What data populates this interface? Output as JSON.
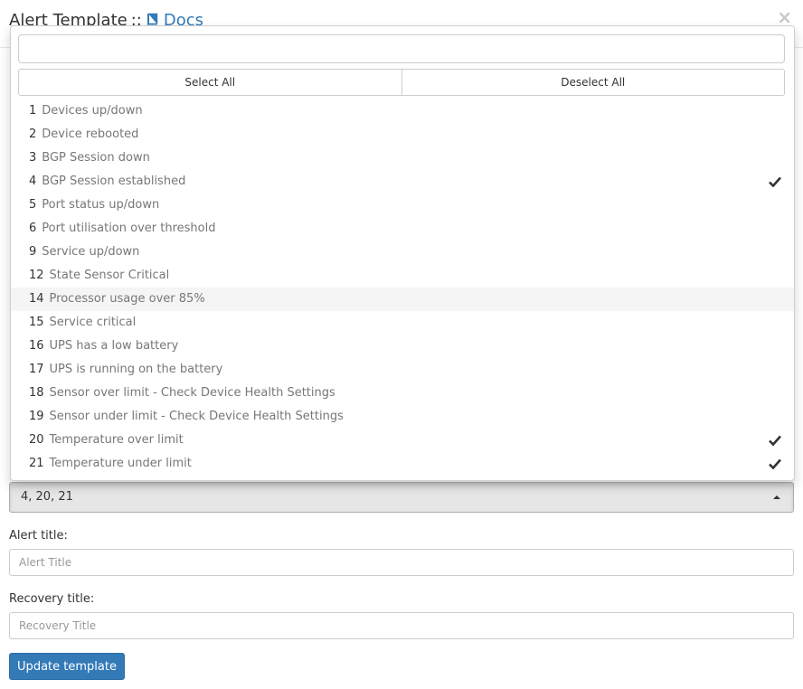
{
  "modal": {
    "title": "Alert Template",
    "separator": "::",
    "docs_label": "Docs",
    "close_label": "×"
  },
  "dropdown": {
    "search_value": "",
    "select_all": "Select All",
    "deselect_all": "Deselect All",
    "options": [
      {
        "num": "1",
        "label": "Devices up/down",
        "checked": false
      },
      {
        "num": "2",
        "label": "Device rebooted",
        "checked": false
      },
      {
        "num": "3",
        "label": "BGP Session down",
        "checked": false
      },
      {
        "num": "4",
        "label": "BGP Session established",
        "checked": true
      },
      {
        "num": "5",
        "label": "Port status up/down",
        "checked": false
      },
      {
        "num": "6",
        "label": "Port utilisation over threshold",
        "checked": false
      },
      {
        "num": "9",
        "label": "Service up/down",
        "checked": false
      },
      {
        "num": "12",
        "label": "State Sensor Critical",
        "checked": false
      },
      {
        "num": "14",
        "label": "Processor usage over 85%",
        "checked": false
      },
      {
        "num": "15",
        "label": "Service critical",
        "checked": false
      },
      {
        "num": "16",
        "label": "UPS has a low battery",
        "checked": false
      },
      {
        "num": "17",
        "label": "UPS is running on the battery",
        "checked": false
      },
      {
        "num": "18",
        "label": "Sensor over limit - Check Device Health Settings",
        "checked": false
      },
      {
        "num": "19",
        "label": "Sensor under limit - Check Device Health Settings",
        "checked": false
      },
      {
        "num": "20",
        "label": "Temperature over limit",
        "checked": true
      },
      {
        "num": "21",
        "label": "Temperature under limit",
        "checked": true
      }
    ]
  },
  "select": {
    "value": "4, 20, 21"
  },
  "form": {
    "alert_title_label": "Alert title:",
    "alert_title_placeholder": "Alert Title",
    "recovery_title_label": "Recovery title:",
    "recovery_title_placeholder": "Recovery Title",
    "update_button": "Update template"
  },
  "colors": {
    "primary": "#337ab7",
    "link": "#337ab7"
  }
}
